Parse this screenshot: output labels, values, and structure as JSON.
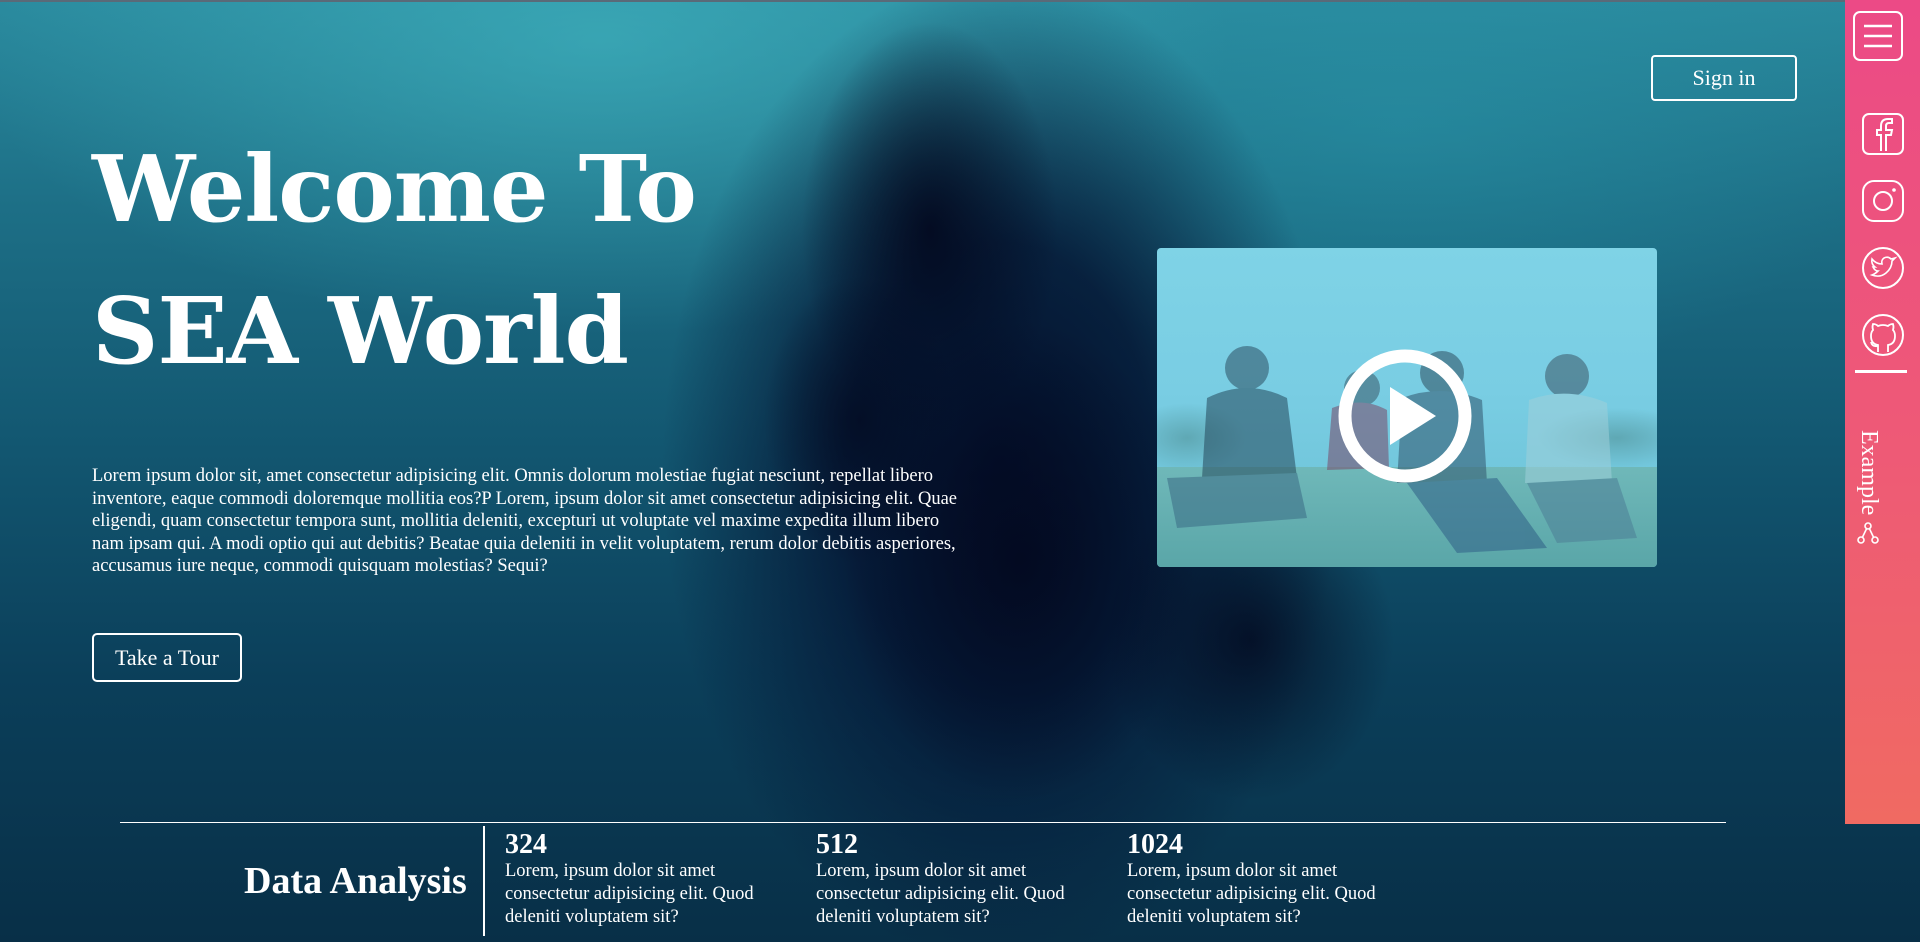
{
  "header": {
    "signin_label": "Sign in"
  },
  "hero": {
    "title": "Welcome To SEA World",
    "body": "Lorem ipsum dolor sit, amet consectetur adipisicing elit. Omnis dolorum molestiae fugiat nesciunt, repellat libero inventore, eaque commodi doloremque mollitia eos?P Lorem, ipsum dolor sit amet consectetur adipisicing elit. Quae eligendi, quam consectetur tempora sunt, mollitia deleniti, excepturi ut voluptate vel maxime expedita illum libero nam ipsam qui. A modi optio qui aut debitis? Beatae quia deleniti in velit voluptatem, rerum dolor debitis asperiores, accusamus iure neque, commodi quisquam molestias? Sequi?",
    "tour_label": "Take a Tour"
  },
  "video": {
    "play_icon": "play-icon"
  },
  "side_panel": {
    "icons": [
      "menu-icon",
      "facebook-icon",
      "instagram-icon",
      "twitter-icon",
      "github-icon"
    ],
    "example_label": "Example",
    "example_icon": "share-icon"
  },
  "data_analysis": {
    "title": "Data Analysis",
    "stats": [
      {
        "value": "324",
        "text": "Lorem, ipsum dolor sit amet consectetur adipisicing elit. Quod deleniti voluptatem sit?"
      },
      {
        "value": "512",
        "text": "Lorem, ipsum dolor sit amet consectetur adipisicing elit. Quod deleniti voluptatem sit?"
      },
      {
        "value": "1024",
        "text": "Lorem, ipsum dolor sit amet consectetur adipisicing elit. Quod deleniti voluptatem sit?"
      }
    ]
  },
  "colors": {
    "side_panel_top": "#ec4a86",
    "side_panel_bottom": "#f06a62",
    "sea_dark": "#082f47",
    "sea_light": "#2a8a9e",
    "video_tint": "#7fd3e6"
  }
}
